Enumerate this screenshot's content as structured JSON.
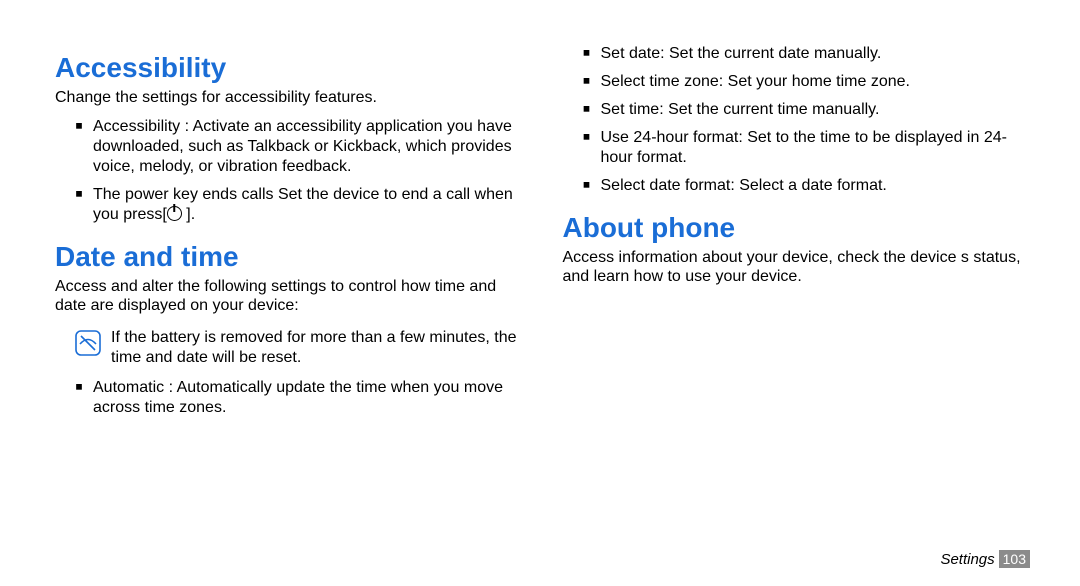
{
  "left": {
    "accessibility": {
      "title": "Accessibility",
      "lead": "Change the settings for accessibility features.",
      "item1": "Accessibility : Activate an accessibility application you have downloaded, such as Talkback or Kickback, which provides voice, melody, or vibration feedback.",
      "item2_pre": "The power key ends calls Set the device to end a call when you press[",
      "item2_post": " ]."
    },
    "datetime": {
      "title": "Date and time",
      "lead": "Access and alter the following settings to control how time and date are displayed on your device:",
      "note": "If the battery is removed for more than a few minutes, the time and date will be reset.",
      "item_auto": "Automatic : Automatically update the time when you move across time zones."
    }
  },
  "right": {
    "datetime_items": {
      "set_date": "Set date: Set the current date manually.",
      "tz": "Select time zone: Set your home time zone.",
      "set_time": "Set time: Set the current time manually.",
      "h24": "Use 24-hour format: Set to the time to be displayed in 24-hour format.",
      "date_fmt": "Select date format: Select a date format."
    },
    "about": {
      "title": "About phone",
      "lead": "Access information about your device, check the device s status, and learn how to use your device."
    }
  },
  "footer": {
    "section": "Settings",
    "page": "103"
  },
  "bullet_glyph": "￭"
}
